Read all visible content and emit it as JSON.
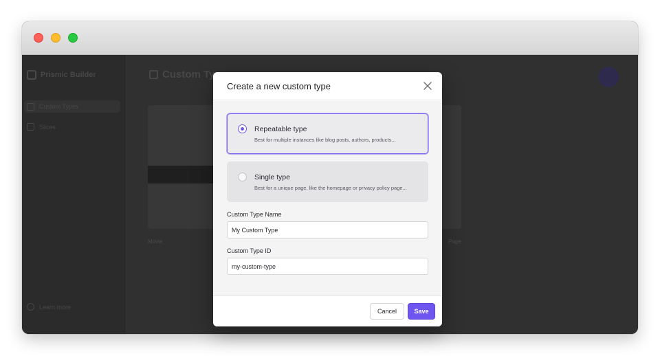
{
  "app": {
    "sidebar": {
      "logo_text": "Prismic Builder",
      "items": [
        {
          "label": "Custom Types",
          "icon": "custom-types-icon"
        },
        {
          "label": "Slices",
          "icon": "slices-icon"
        }
      ],
      "footer": {
        "label": "Learn more",
        "icon": "info-icon"
      }
    },
    "main": {
      "title": "Custom Types",
      "cards": [
        {
          "label": "Movie"
        },
        {
          "label": "Page"
        }
      ]
    }
  },
  "modal": {
    "title": "Create a new custom type",
    "options": [
      {
        "title": "Repeatable type",
        "description": "Best for multiple instances like blog posts, authors, products...",
        "selected": true
      },
      {
        "title": "Single type",
        "description": "Best for a unique page, like the homepage or privacy policy page...",
        "selected": false
      }
    ],
    "name_field": {
      "label": "Custom Type Name",
      "value": "My Custom Type"
    },
    "id_field": {
      "label": "Custom Type ID",
      "value": "my-custom-type"
    },
    "cancel_label": "Cancel",
    "save_label": "Save"
  },
  "colors": {
    "accent": "#6e55f0",
    "selected_border": "#7c68ee",
    "overlay_background": "#2f2f30"
  }
}
